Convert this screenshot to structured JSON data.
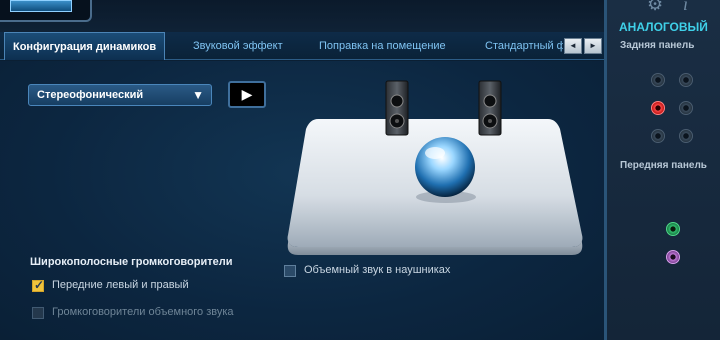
{
  "tabs": [
    {
      "label": "Конфигурация динамиков",
      "active": true
    },
    {
      "label": "Звуковой эффект",
      "active": false
    },
    {
      "label": "Поправка на помещение",
      "active": false
    },
    {
      "label": "Стандартный ф",
      "active": false
    }
  ],
  "tab_arrows": {
    "left": "◄",
    "right": "►"
  },
  "speaker_config": {
    "selected": "Стереофонический",
    "dropdown_arrow": "▼",
    "play_glyph": "▶"
  },
  "wideband": {
    "heading": "Широкополосные громкоговорители",
    "front_lr": {
      "label": "Передние левый и правый",
      "checked": true
    },
    "surround": {
      "label": "Громкоговорители объемного звука",
      "checked": false,
      "enabled": false
    }
  },
  "headphones_surround": {
    "label": "Объемный звук в наушниках",
    "checked": false
  },
  "right_panel": {
    "title": "АНАЛОГОВЫЙ",
    "back_panel_label": "Задняя панель",
    "front_panel_label": "Передняя панель",
    "icons": [
      "gear-icon",
      "info-icon"
    ]
  },
  "colors": {
    "accent": "#3fd0e8",
    "red_jack": "#e02020",
    "green_jack": "#2fbf6f",
    "purple_jack": "#b070d0"
  }
}
